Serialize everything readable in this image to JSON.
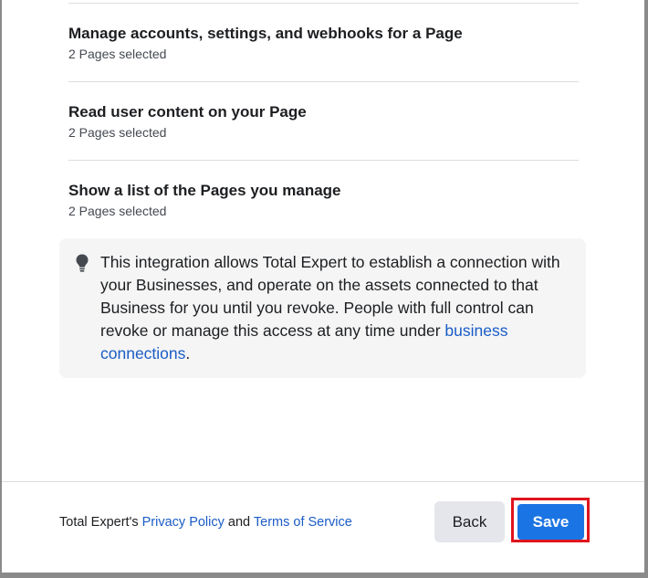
{
  "permissions": [
    {
      "title": "Manage accounts, settings, and webhooks for a Page",
      "subtitle": "2 Pages selected"
    },
    {
      "title": "Read user content on your Page",
      "subtitle": "2 Pages selected"
    },
    {
      "title": "Show a list of the Pages you manage",
      "subtitle": "2 Pages selected"
    }
  ],
  "info": {
    "icon": "lightbulb-icon",
    "text": "This integration allows Total Expert to establish a connection with your Businesses, and operate on the assets connected to that Business for you until you revoke. People with full control can revoke or manage this access at any time under ",
    "link": "business connections",
    "end": "."
  },
  "footer": {
    "prefix": "Total Expert's ",
    "privacy_link": "Privacy Policy",
    "and": " and ",
    "terms_link": "Terms of Service",
    "back_label": "Back",
    "save_label": "Save"
  },
  "colors": {
    "primary": "#1b74e4",
    "link": "#1a5cc6",
    "highlight": "#e0141e"
  }
}
